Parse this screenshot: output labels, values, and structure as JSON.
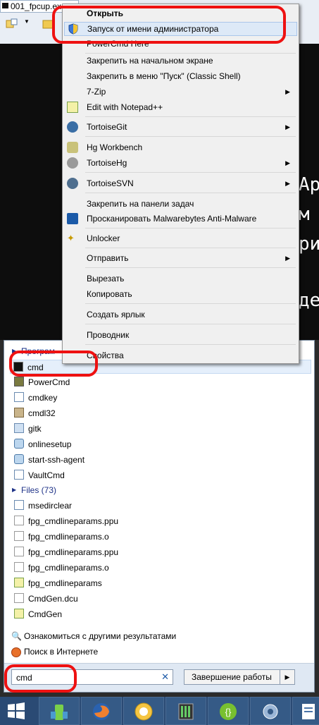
{
  "explorer": {
    "tab_label": "001_fpcup.exe"
  },
  "console_lines": [
    "Ар",
    "м",
    "ри",
    "де"
  ],
  "context_menu": {
    "items": [
      {
        "label": "Открыть",
        "bold": true
      },
      {
        "label": "Запуск от имени администратора",
        "icon": "shield-icon"
      },
      {
        "label": "PowerCmd Here"
      },
      {
        "label": "Закрепить на начальном экране"
      },
      {
        "label": "Закрепить в меню \"Пуск\" (Classic Shell)"
      },
      {
        "label": "7-Zip",
        "submenu": true
      },
      {
        "label": "Edit with Notepad++",
        "icon": "notepad-icon"
      },
      {
        "label": "TortoiseGit",
        "icon": "tortoisegit-icon",
        "submenu": true
      },
      {
        "label": "Hg Workbench",
        "icon": "workbench-icon"
      },
      {
        "label": "TortoiseHg",
        "icon": "tortoisehg-icon",
        "submenu": true
      },
      {
        "label": "TortoiseSVN",
        "icon": "tortoisesvn-icon",
        "submenu": true
      },
      {
        "label": "Закрепить на панели задач"
      },
      {
        "label": "Просканировать Malwarebytes Anti-Malware",
        "icon": "malwarebytes-icon"
      },
      {
        "label": "Unlocker",
        "icon": "unlocker-icon"
      },
      {
        "label": "Отправить",
        "submenu": true
      },
      {
        "label": "Вырезать"
      },
      {
        "label": "Копировать"
      },
      {
        "label": "Создать ярлык"
      },
      {
        "label": "Проводник"
      },
      {
        "label": "Свойства"
      }
    ]
  },
  "start_menu": {
    "programs_header": "Програм",
    "programs": [
      {
        "label": "cmd",
        "icon": "console-icon",
        "selected": true
      },
      {
        "label": "PowerCmd",
        "icon": "powercmd-icon"
      },
      {
        "label": "cmdkey",
        "icon": "app-icon"
      },
      {
        "label": "cmdl32",
        "icon": "app-gear-icon"
      },
      {
        "label": "gitk",
        "icon": "gitk-icon"
      },
      {
        "label": "onlinesetup",
        "icon": "globe-icon"
      },
      {
        "label": "start-ssh-agent",
        "icon": "globe-icon"
      },
      {
        "label": "VaultCmd",
        "icon": "app-icon"
      }
    ],
    "files_header": "Files (73)",
    "files": [
      {
        "label": "msedirclear",
        "icon": "app-icon"
      },
      {
        "label": "fpg_cmdlineparams.ppu",
        "icon": "file-icon"
      },
      {
        "label": "fpg_cmdlineparams.o",
        "icon": "file-icon"
      },
      {
        "label": "fpg_cmdlineparams.ppu",
        "icon": "file-icon"
      },
      {
        "label": "fpg_cmdlineparams.o",
        "icon": "file-icon"
      },
      {
        "label": "fpg_cmdlineparams",
        "icon": "notepad-icon"
      },
      {
        "label": "CmdGen.dcu",
        "icon": "file-icon"
      },
      {
        "label": "CmdGen",
        "icon": "notepad-icon"
      }
    ],
    "more_results": "Ознакомиться с другими результатами",
    "web_search": "Поиск в Интернете",
    "search_value": "cmd",
    "shutdown_label": "Завершение работы"
  },
  "colors": {
    "annotation": "#e11111",
    "taskbar": "#2a4a74",
    "highlight": "#dde9f7"
  }
}
